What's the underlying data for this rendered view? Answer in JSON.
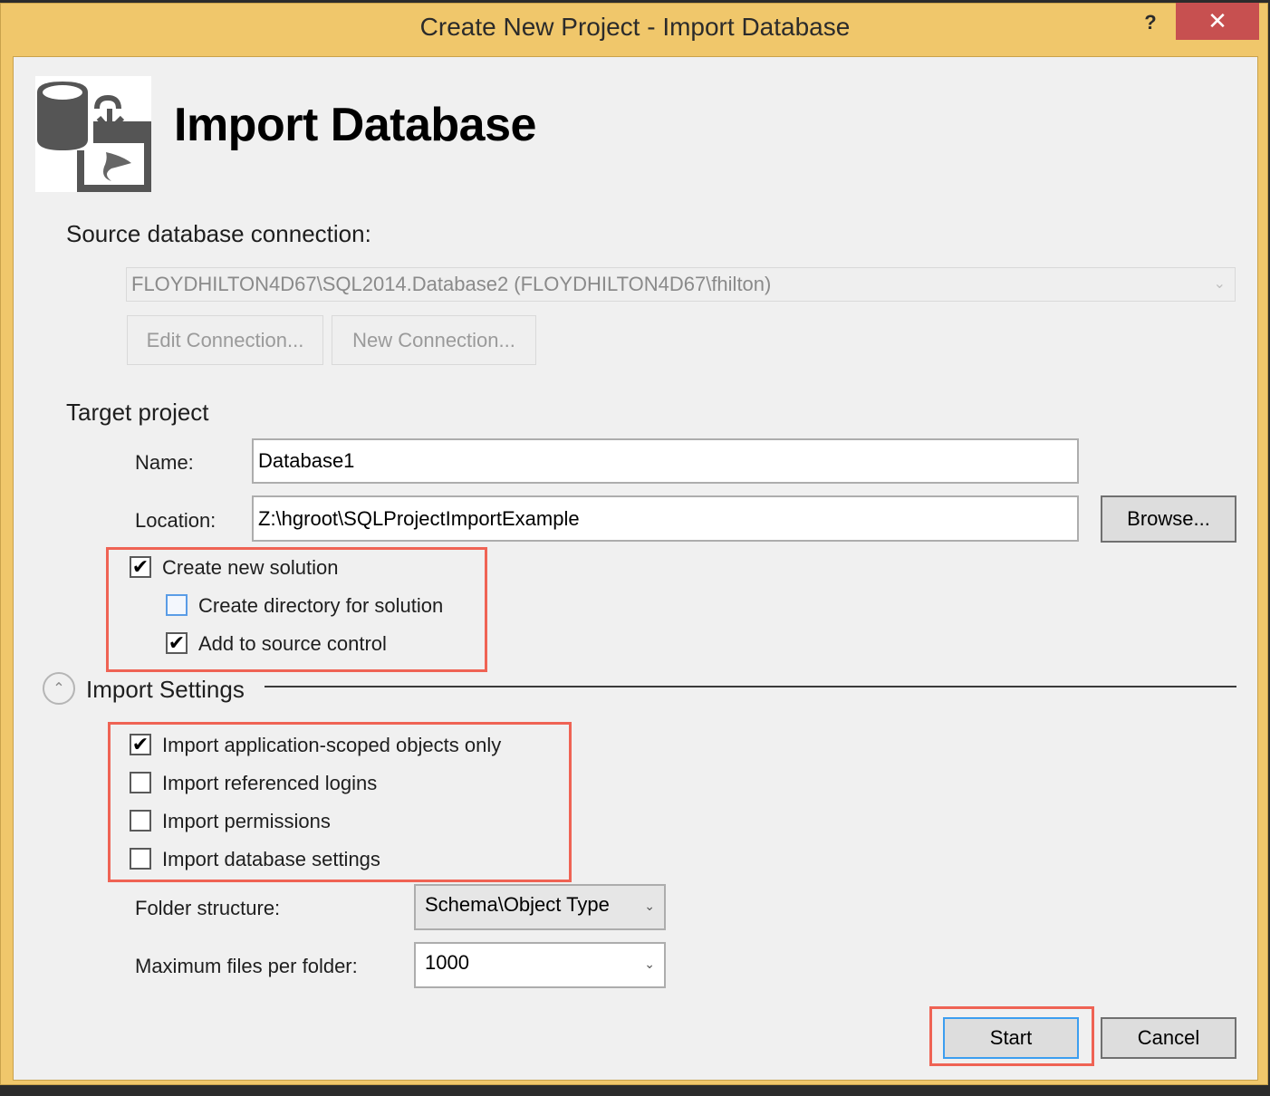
{
  "window": {
    "title": "Create New Project - Import Database",
    "help_label": "?",
    "close_label": "✕"
  },
  "header": {
    "title": "Import Database",
    "icon": "import-database-icon"
  },
  "source": {
    "heading": "Source database connection:",
    "connection_value": "FLOYDHILTON4D67\\SQL2014.Database2 (FLOYDHILTON4D67\\fhilton)",
    "edit_connection_label": "Edit Connection...",
    "new_connection_label": "New Connection..."
  },
  "target": {
    "heading": "Target project",
    "name_label": "Name:",
    "name_value": "Database1",
    "location_label": "Location:",
    "location_value": "Z:\\hgroot\\SQLProjectImportExample",
    "browse_label": "Browse...",
    "options": [
      {
        "label": "Create new solution",
        "checked": true
      },
      {
        "label": "Create directory for solution",
        "checked": false
      },
      {
        "label": "Add to source control",
        "checked": true
      }
    ]
  },
  "import_settings": {
    "heading": "Import Settings",
    "options": [
      {
        "label": "Import application-scoped objects only",
        "checked": true
      },
      {
        "label": "Import referenced logins",
        "checked": false
      },
      {
        "label": "Import permissions",
        "checked": false
      },
      {
        "label": "Import database settings",
        "checked": false
      }
    ],
    "folder_structure_label": "Folder structure:",
    "folder_structure_value": "Schema\\Object Type",
    "max_files_label": "Maximum files per folder:",
    "max_files_value": "1000"
  },
  "footer": {
    "start_label": "Start",
    "cancel_label": "Cancel"
  },
  "glyphs": {
    "check": "✔",
    "chevron_down": "⌄",
    "chevron_up": "︿"
  },
  "colors": {
    "title_bar": "#f0c76b",
    "close_button": "#c75050",
    "highlight_box": "#ef6354",
    "focus_blue": "#3c9ef0"
  }
}
